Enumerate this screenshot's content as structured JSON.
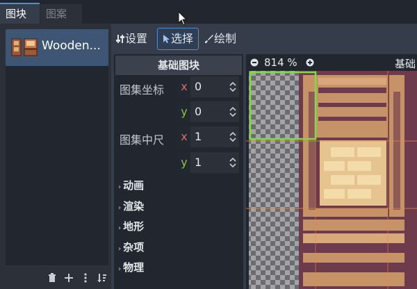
{
  "tabs": [
    {
      "label": "图块",
      "active": true
    },
    {
      "label": "图案",
      "active": false
    }
  ],
  "sources": {
    "items": [
      {
        "label": "Wooden..."
      }
    ]
  },
  "toolbar": {
    "settings_label": "设置",
    "select_label": "选择",
    "paint_label": "绘制"
  },
  "inspector": {
    "header": "基础图块",
    "atlas_coords_label": "图集坐标",
    "atlas_coords": {
      "x": "0",
      "y": "0"
    },
    "atlas_size_label": "图集中尺",
    "atlas_size": {
      "x": "1",
      "y": "1"
    },
    "axis_x": "x",
    "axis_y": "y",
    "sections": [
      "动画",
      "渲染",
      "地形",
      "杂项",
      "物理"
    ]
  },
  "canvas": {
    "zoom_label": "814 %",
    "title_partial": "基础"
  },
  "colors": {
    "accent": "#5a8cc9",
    "selection": "#7ddd3a",
    "panel": "#2b3039",
    "background": "#363d4a"
  }
}
